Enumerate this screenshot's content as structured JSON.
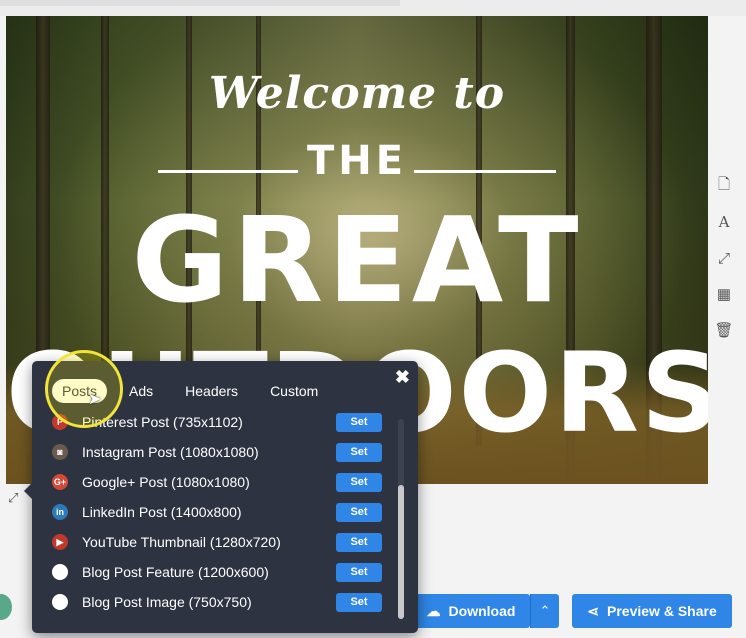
{
  "canvas": {
    "line1": "Welcome to",
    "line2": "THE",
    "line3": "GREAT",
    "line4": "OUTDOORS"
  },
  "tools": [
    {
      "name": "page-icon",
      "glyph": "🗋"
    },
    {
      "name": "text-style-icon",
      "glyph": "A"
    },
    {
      "name": "resize-icon",
      "glyph": "⤢"
    },
    {
      "name": "grid-icon",
      "glyph": "▦"
    },
    {
      "name": "trash-icon",
      "glyph": "🗑"
    }
  ],
  "popover": {
    "tabs": [
      "Posts",
      "Ads",
      "Headers",
      "Custom"
    ],
    "active_tab": "Posts",
    "close_glyph": "✖",
    "set_label": "Set",
    "items": [
      {
        "label": "Pinterest Post (735x1102)",
        "icon": "pinterest-icon",
        "glyph": "P",
        "color": "#c0392b"
      },
      {
        "label": "Instagram Post (1080x1080)",
        "icon": "instagram-icon",
        "glyph": "◙",
        "color": "#6b5b4c"
      },
      {
        "label": "Google+ Post (1080x1080)",
        "icon": "google-plus-icon",
        "glyph": "G+",
        "color": "#d34836"
      },
      {
        "label": "LinkedIn Post (1400x800)",
        "icon": "linkedin-icon",
        "glyph": "in",
        "color": "#2e7ab8"
      },
      {
        "label": "YouTube Thumbnail (1280x720)",
        "icon": "youtube-icon",
        "glyph": "▶",
        "color": "#c0392b"
      },
      {
        "label": "Blog Post Feature (1200x600)",
        "icon": "blog-feature-icon",
        "glyph": "",
        "color": "#ffffff"
      },
      {
        "label": "Blog Post Image (750x750)",
        "icon": "blog-image-icon",
        "glyph": "",
        "color": "#ffffff"
      }
    ]
  },
  "bottom": {
    "download_label": "Download",
    "download_glyph": "☁",
    "caret_glyph": "⌃",
    "share_label": "Preview & Share",
    "share_glyph": "⋖"
  },
  "colors": {
    "accent": "#2f86e6",
    "popover_bg": "#2d3340",
    "highlight": "#f1e43a"
  }
}
